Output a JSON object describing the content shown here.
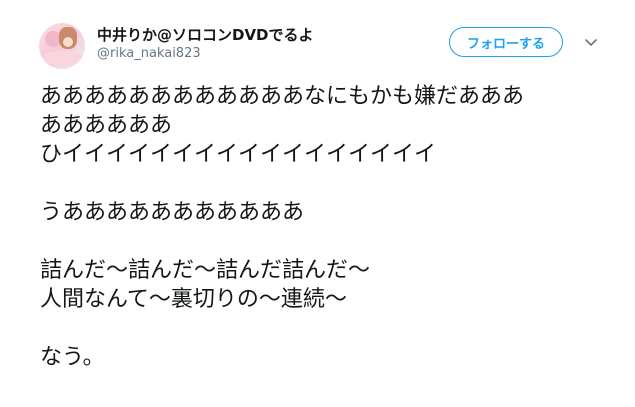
{
  "user": {
    "display_name": "中井りか@ソロコンDVDでるよ",
    "screen_name": "@rika_nakai823"
  },
  "actions": {
    "follow_label": "フォローする"
  },
  "tweet": {
    "lines": [
      "ああああああああああああなにもかも嫌だあああ",
      "ああああああ",
      "ひイイイイイイイイイイイイイイイイイ",
      "",
      "うあああああああああああ",
      "",
      "詰んだ〜詰んだ〜詰んだ詰んだ〜",
      "人間なんて〜裏切りの〜連続〜",
      "",
      "なう。"
    ]
  },
  "colors": {
    "accent": "#1da1f2",
    "text": "#14171a",
    "secondary": "#657786"
  }
}
